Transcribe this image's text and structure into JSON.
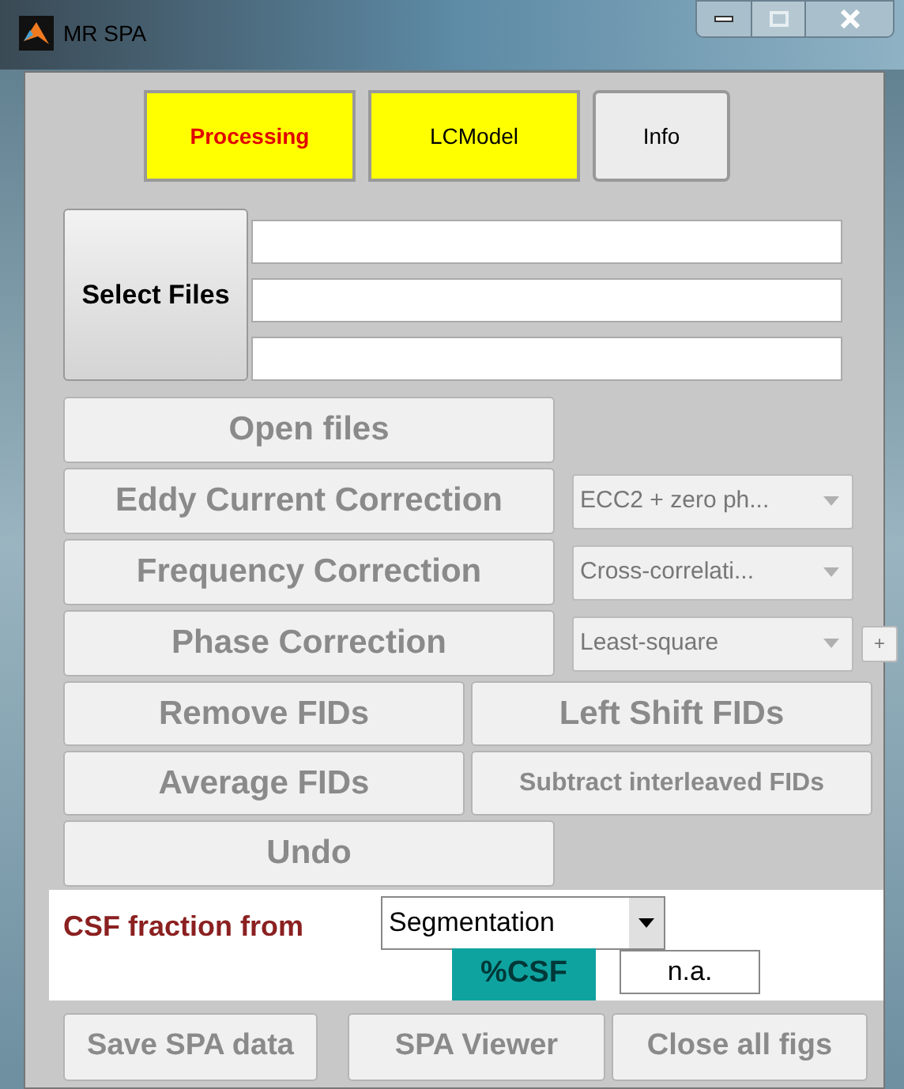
{
  "window": {
    "title": "MR SPA"
  },
  "tabs": [
    {
      "label": "Processing",
      "selected": true,
      "color": "#ffff00"
    },
    {
      "label": "LCModel",
      "selected": false,
      "color": "#ffff00"
    },
    {
      "label": "Info",
      "selected": false
    }
  ],
  "select_files": {
    "label": "Select Files"
  },
  "rows": [
    {
      "kind": "wide",
      "buttons": [
        {
          "label": "Open files",
          "disabled": true
        }
      ]
    },
    {
      "kind": "wide",
      "buttons": [
        {
          "label": "Eddy Current Correction",
          "disabled": true
        }
      ],
      "dropdown": {
        "value": "ECC2 + zero ph...",
        "disabled": true
      }
    },
    {
      "kind": "wide",
      "buttons": [
        {
          "label": "Frequency Correction",
          "disabled": true
        }
      ],
      "dropdown": {
        "value": "Cross-correlati...",
        "disabled": true
      }
    },
    {
      "kind": "wide",
      "buttons": [
        {
          "label": "Phase Correction",
          "disabled": true
        }
      ],
      "dropdown": {
        "value": "Least-square",
        "disabled": true
      },
      "extra": "+"
    },
    {
      "kind": "pair",
      "buttons": [
        {
          "label": "Remove FIDs",
          "disabled": true
        },
        {
          "label": "Left Shift FIDs",
          "disabled": true
        }
      ]
    },
    {
      "kind": "pair",
      "buttons": [
        {
          "label": "Average FIDs",
          "disabled": true
        },
        {
          "label": "Subtract interleaved FIDs",
          "disabled": true
        }
      ]
    },
    {
      "kind": "wide",
      "buttons": [
        {
          "label": "Undo",
          "disabled": true
        }
      ]
    }
  ],
  "csf": {
    "label": "CSF fraction from",
    "dropdown": {
      "value": "Segmentation"
    },
    "badge": "%CSF",
    "value": "n.a."
  },
  "bottom_buttons": [
    {
      "label": "Save SPA data",
      "disabled": true
    },
    {
      "label": "SPA Viewer",
      "disabled": true
    },
    {
      "label": "Close all figs",
      "disabled": true
    }
  ]
}
